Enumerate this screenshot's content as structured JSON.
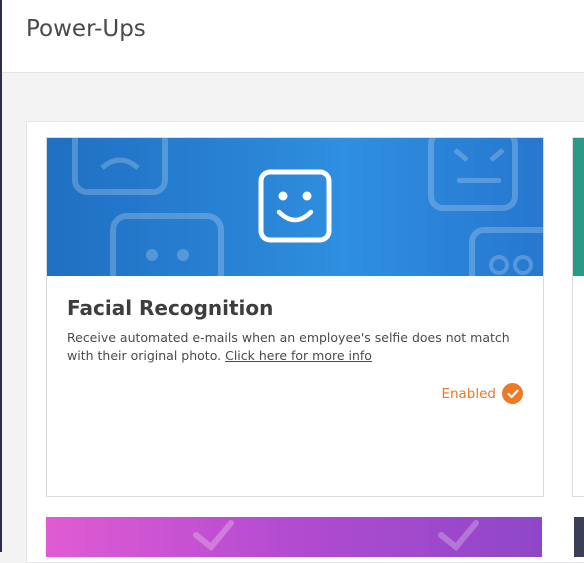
{
  "header": {
    "title": "Power-Ups"
  },
  "cards": [
    {
      "title": "Facial Recognition",
      "description": "Receive automated e-mails when an employee's selfie does not match with their original photo.",
      "link_label": "Click here for more info",
      "status_label": "Enabled",
      "banner_icon": "smiley-face-icon",
      "banner_colors": [
        "#1f6fc2",
        "#2f8fe0"
      ],
      "status_color": "#ee7a25"
    }
  ]
}
